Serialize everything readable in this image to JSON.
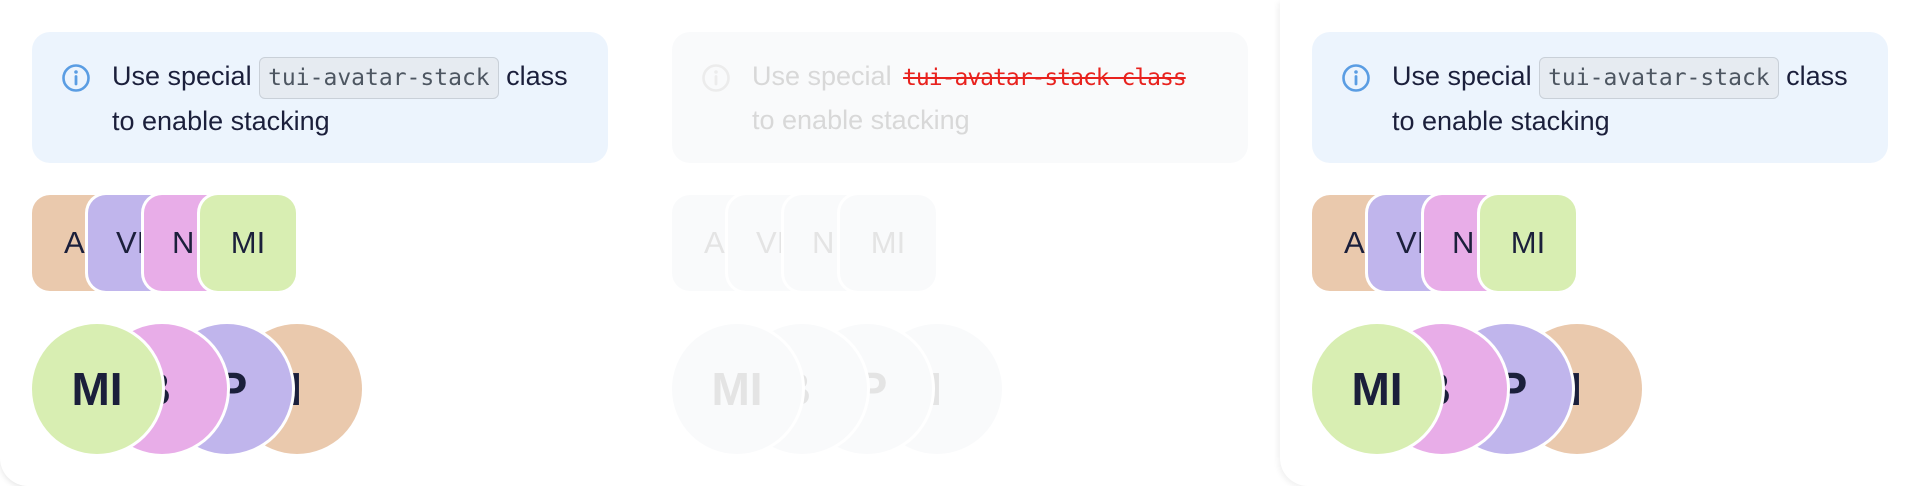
{
  "colors": {
    "notice_bg": "#ecf4fd",
    "info_icon": "#5a9de3",
    "avatar_peach": "#eac9ad",
    "avatar_lavender": "#c0b5ec",
    "avatar_pink": "#e8ade8",
    "avatar_green": "#d8eeb2",
    "text_dark": "#1b1f3b",
    "error_red": "#e8221e"
  },
  "panels": [
    {
      "notice": {
        "text_before": "Use special",
        "code": "tui-avatar-stack",
        "text_after": "class to enable stacking"
      },
      "small_stack": [
        "A",
        "VI",
        "NI",
        "MI"
      ],
      "big_stack": [
        "MI",
        "IB",
        "VP",
        "AI"
      ]
    },
    {
      "notice": {
        "text_before": "Use special",
        "code": "tui-avatar-stack class",
        "text_after": "to enable stacking"
      },
      "small_stack": [
        "A",
        "VI",
        "NI",
        "MI"
      ],
      "big_stack": [
        "MI",
        "IB",
        "VP",
        "AI"
      ]
    },
    {
      "notice": {
        "text_before": "Use special",
        "code": "tui-avatar-stack",
        "text_after": "class to enable stacking"
      },
      "small_stack": [
        "A",
        "VI",
        "NI",
        "MI"
      ],
      "big_stack": [
        "MI",
        "IB",
        "VP",
        "AI"
      ]
    }
  ]
}
